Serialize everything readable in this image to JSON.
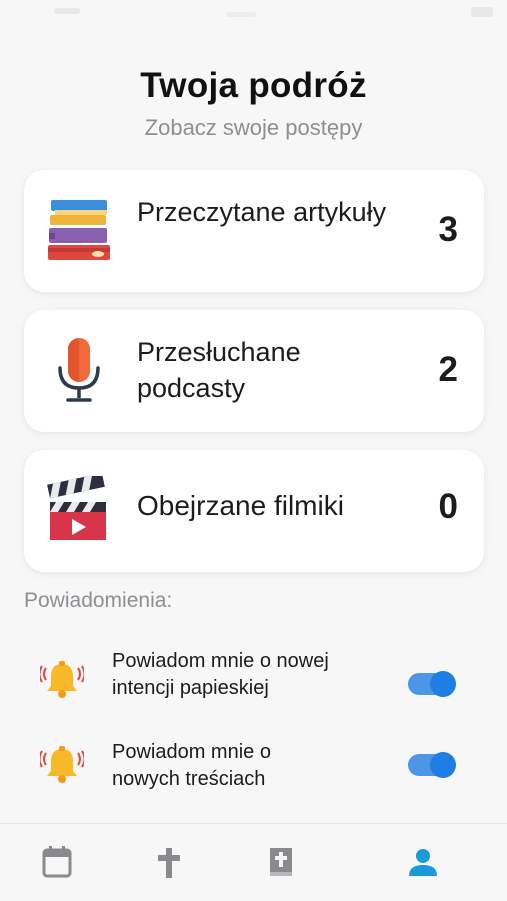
{
  "header": {
    "title": "Twoja podróż",
    "subtitle": "Zobacz swoje postępy"
  },
  "stats": [
    {
      "label": "Przeczytane artykuły",
      "count": "3",
      "icon": "books-icon"
    },
    {
      "label": "Przesłuchane podcasty",
      "count": "2",
      "icon": "microphone-icon"
    },
    {
      "label": "Obejrzane filmiki",
      "count": "0",
      "icon": "clapperboard-icon"
    }
  ],
  "notifications": {
    "section_label": "Powiadomienia:",
    "items": [
      {
        "text": "Powiadom mnie o nowej intencji papieskiej",
        "enabled": true,
        "icon": "bell-icon"
      },
      {
        "text": "Powiadom mnie o nowych treściach",
        "enabled": true,
        "icon": "bell-icon"
      }
    ]
  },
  "nav": {
    "items": [
      {
        "icon": "calendar-icon",
        "active": false
      },
      {
        "icon": "cross-icon",
        "active": false
      },
      {
        "icon": "bible-icon",
        "active": false
      },
      {
        "icon": "person-icon",
        "active": true
      }
    ],
    "active_color": "#1a9ad6",
    "inactive_color": "#8a8a8e"
  },
  "colors": {
    "toggle_track": "#4d95e6",
    "toggle_knob": "#1e7ee3"
  }
}
